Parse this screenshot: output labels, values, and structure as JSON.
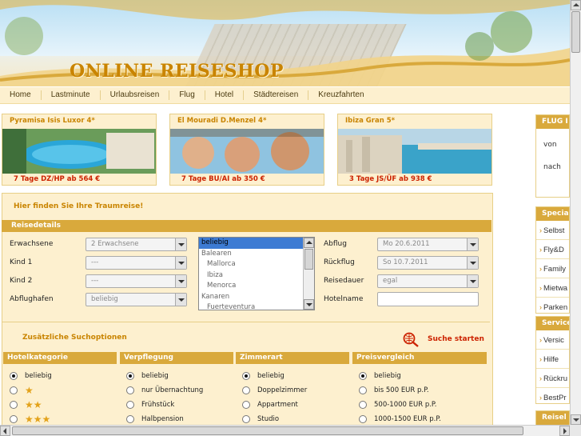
{
  "header": {
    "logo_text": "ONLINE REISESHOP"
  },
  "nav": {
    "items": [
      "Home",
      "Lastminute",
      "Urlaubsreisen",
      "Flug",
      "Hotel",
      "Städtereisen",
      "Kreuzfahrten"
    ]
  },
  "teasers": [
    {
      "title": "Pyramisa Isis Luxor 4*",
      "offer": "7 Tage DZ/HP ab 564 €"
    },
    {
      "title": "El Mouradi D.Menzel 4*",
      "offer": "7 Tage BU/AI ab 350 €"
    },
    {
      "title": "Ibiza Gran 5*",
      "offer": "3 Tage JS/ÜF ab 938 €"
    }
  ],
  "search": {
    "title": "Hier finden Sie Ihre Traumreise!",
    "section_title": "Reisedetails",
    "labels": {
      "adults": "Erwachsene",
      "child1": "Kind 1",
      "child2": "Kind 2",
      "airport": "Abflughafen",
      "departure": "Abflug",
      "return": "Rückflug",
      "duration": "Reisedauer",
      "hotelname": "Hotelname"
    },
    "values": {
      "adults": "2 Erwachsene",
      "child1": "---",
      "child2": "---",
      "airport": "beliebig",
      "departure": "Mo 20.6.2011",
      "return": "So 10.7.2011",
      "duration": "egal",
      "hotelname": ""
    },
    "destinations": [
      {
        "label": "beliebig",
        "indent": false,
        "selected": true
      },
      {
        "label": "Balearen",
        "indent": false,
        "selected": false
      },
      {
        "label": "Mallorca",
        "indent": true,
        "selected": false
      },
      {
        "label": "Ibiza",
        "indent": true,
        "selected": false
      },
      {
        "label": "Menorca",
        "indent": true,
        "selected": false
      },
      {
        "label": "Kanaren",
        "indent": false,
        "selected": false
      },
      {
        "label": "Fuerteventura",
        "indent": true,
        "selected": false
      }
    ],
    "extra_title": "Zusätzliche Suchoptionen",
    "submit_label": "Suche starten"
  },
  "filters": [
    {
      "title": "Hotelkategorie",
      "options": [
        {
          "label": "beliebig",
          "stars": 0,
          "checked": true
        },
        {
          "label": "",
          "stars": 1,
          "checked": false
        },
        {
          "label": "",
          "stars": 2,
          "checked": false
        },
        {
          "label": "",
          "stars": 3,
          "checked": false
        }
      ]
    },
    {
      "title": "Verpflegung",
      "options": [
        {
          "label": "beliebig",
          "checked": true
        },
        {
          "label": "nur Übernachtung",
          "checked": false
        },
        {
          "label": "Frühstück",
          "checked": false
        },
        {
          "label": "Halbpension",
          "checked": false
        }
      ]
    },
    {
      "title": "Zimmerart",
      "options": [
        {
          "label": "beliebig",
          "checked": true
        },
        {
          "label": "Doppelzimmer",
          "checked": false
        },
        {
          "label": "Appartment",
          "checked": false
        },
        {
          "label": "Studio",
          "checked": false
        }
      ]
    },
    {
      "title": "Preisvergleich",
      "options": [
        {
          "label": "beliebig",
          "checked": true
        },
        {
          "label": "bis 500 EUR p.P.",
          "checked": false
        },
        {
          "label": "500-1000 EUR p.P.",
          "checked": false
        },
        {
          "label": "1000-1500 EUR p.P.",
          "checked": false
        }
      ]
    }
  ],
  "sidebar": {
    "flug": {
      "title": "FLUG I",
      "labels": [
        "von",
        "nach"
      ]
    },
    "specials": {
      "title": "Special",
      "items": [
        "Selbst",
        "Fly&D",
        "Family",
        "Mietwa",
        "Parken"
      ]
    },
    "service": {
      "title": "Service",
      "items": [
        "Versic",
        "Hilfe",
        "Rückru",
        "BestPr"
      ]
    },
    "reise": {
      "title": "Reisel"
    }
  },
  "colors": {
    "accent": "#d9a93c",
    "title": "#c98400",
    "offer": "#cc2200",
    "panel": "#fdf0cf"
  }
}
